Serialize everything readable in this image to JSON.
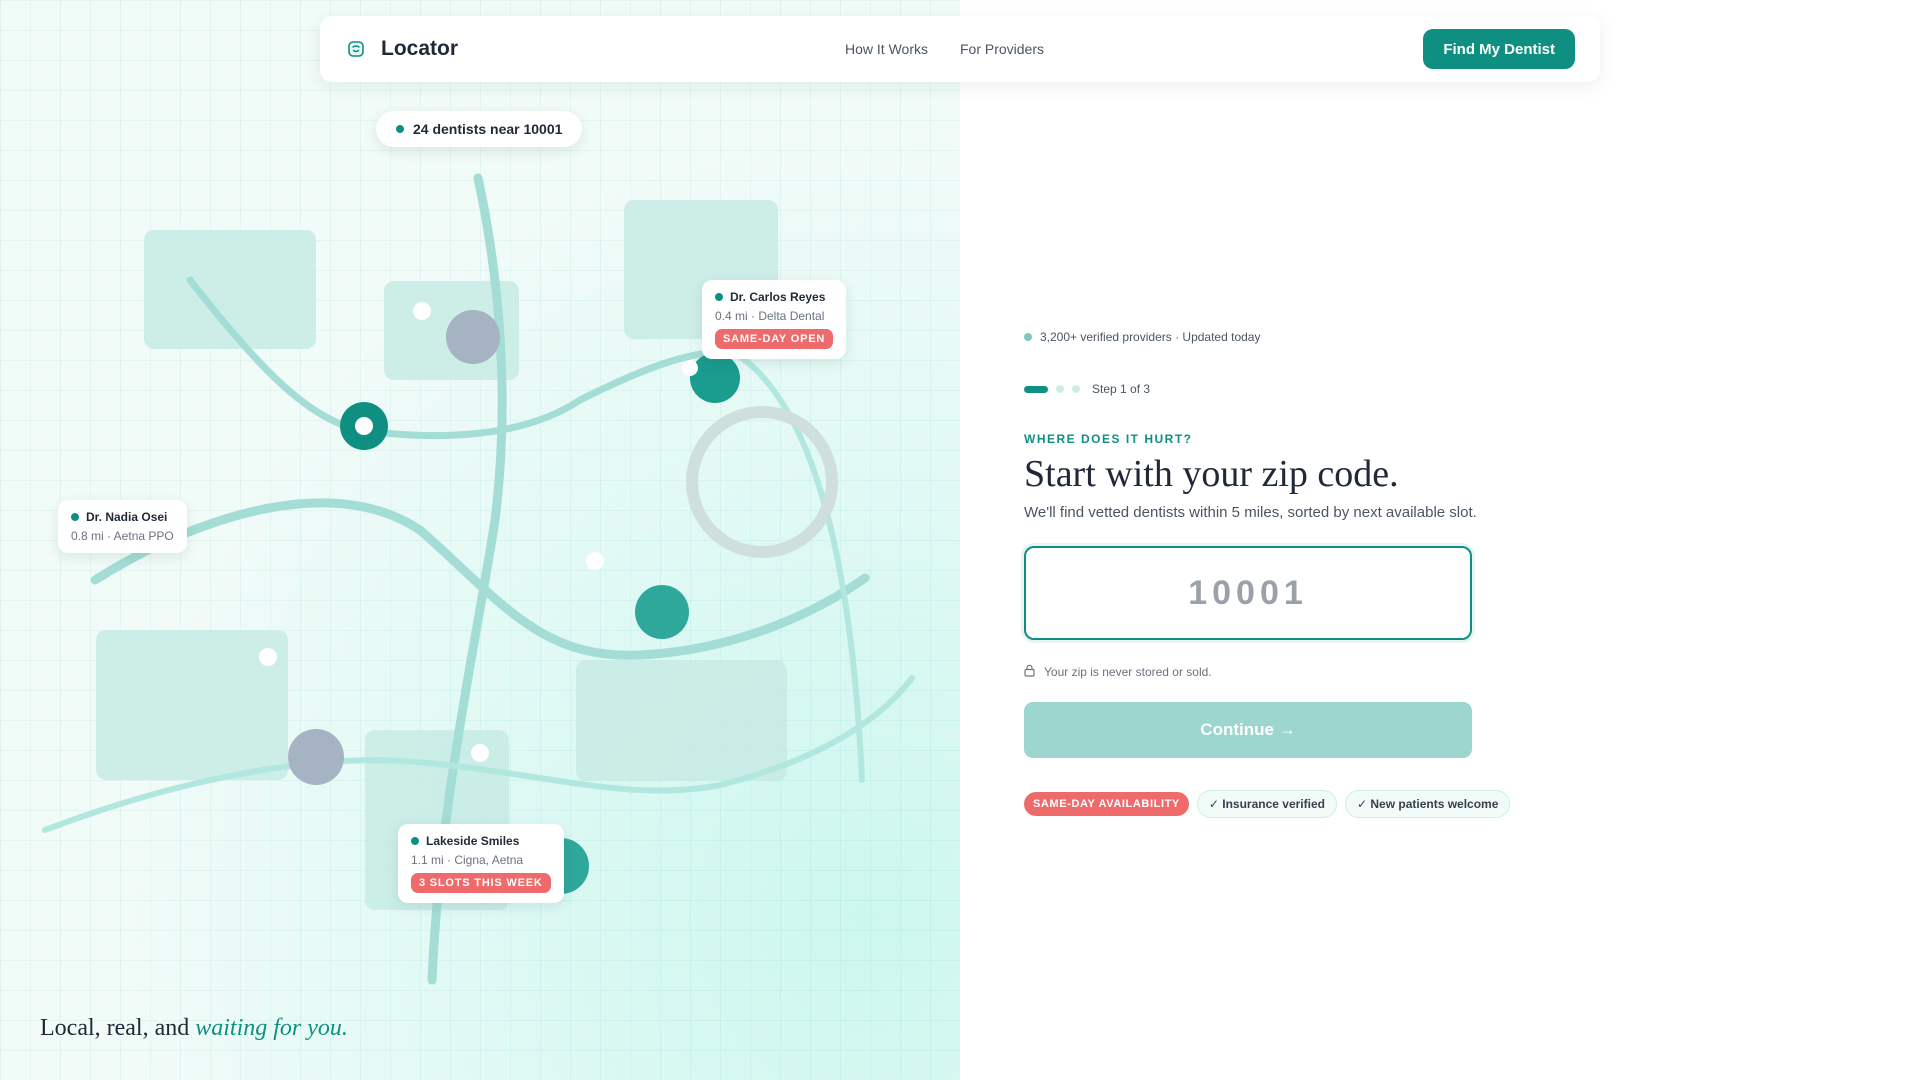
{
  "app": {
    "name": "Locator"
  },
  "header": {
    "nav": [
      "How It Works",
      "For Providers"
    ],
    "cta_label": "Find My Dentist"
  },
  "map": {
    "count_label": "24 dentists near 10001",
    "cards": [
      {
        "name": "Dr. Carlos Reyes",
        "detail": "0.4 mi · Delta Dental",
        "badge": "SAME-DAY OPEN"
      },
      {
        "name": "Dr. Nadia Osei",
        "detail": "0.8 mi · Aetna PPO"
      },
      {
        "name": "Lakeside Smiles",
        "detail": "1.1 mi · Cigna, Aetna",
        "badge": "3 SLOTS THIS WEEK"
      }
    ],
    "tagline_plain": "Local, real, and ",
    "tagline_emph": "waiting for you."
  },
  "form": {
    "meta": "3,200+ verified providers · Updated today",
    "step_label": "Step 1 of 3",
    "eyebrow": "WHERE DOES IT HURT?",
    "title": "Start with your zip code.",
    "subtitle": "We'll find vetted dentists within 5 miles, sorted by next available slot.",
    "zip_placeholder": "10001",
    "zip_value": "",
    "privacy_note": "Your zip is never stored or sold.",
    "continue_label": "Continue →",
    "chips": [
      "SAME-DAY AVAILABILITY",
      "✓ Insurance verified",
      "✓ New patients welcome"
    ]
  },
  "colors": {
    "brand": "#0f8f82",
    "accent_red": "#ef6b6b",
    "map_bg": "#f1fbf8",
    "button_disabled": "#9dd6cf"
  },
  "icons": [
    "tooth-icon",
    "lock-icon",
    "location-pin-icon"
  ]
}
